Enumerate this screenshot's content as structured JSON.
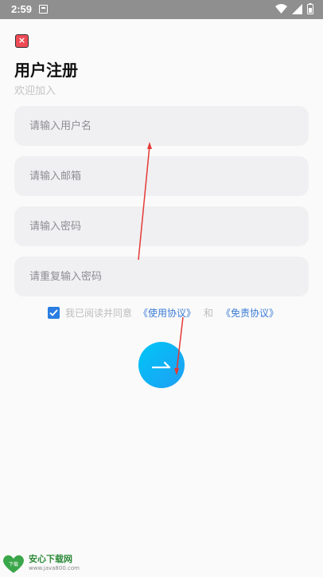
{
  "status_bar": {
    "time": "2:59"
  },
  "header": {
    "title": "用户注册",
    "subtitle": "欢迎加入"
  },
  "form": {
    "username_placeholder": "请输入用户名",
    "email_placeholder": "请输入邮箱",
    "password_placeholder": "请输入密码",
    "confirm_password_placeholder": "请重复输入密码"
  },
  "agreement": {
    "checked": true,
    "text": "我已阅读并同意",
    "terms_link": "《使用协议》",
    "and": "和",
    "disclaimer_link": "《免责协议》"
  },
  "submit": {
    "icon": "arrow-right-icon"
  },
  "watermark": {
    "title": "安心下载网",
    "url": "www.java800.com",
    "logo_text": "下载"
  },
  "colors": {
    "accent": "#1f9ef5",
    "close": "#ee4b55",
    "link": "#3a7bd5",
    "annotation": "#e53935"
  }
}
